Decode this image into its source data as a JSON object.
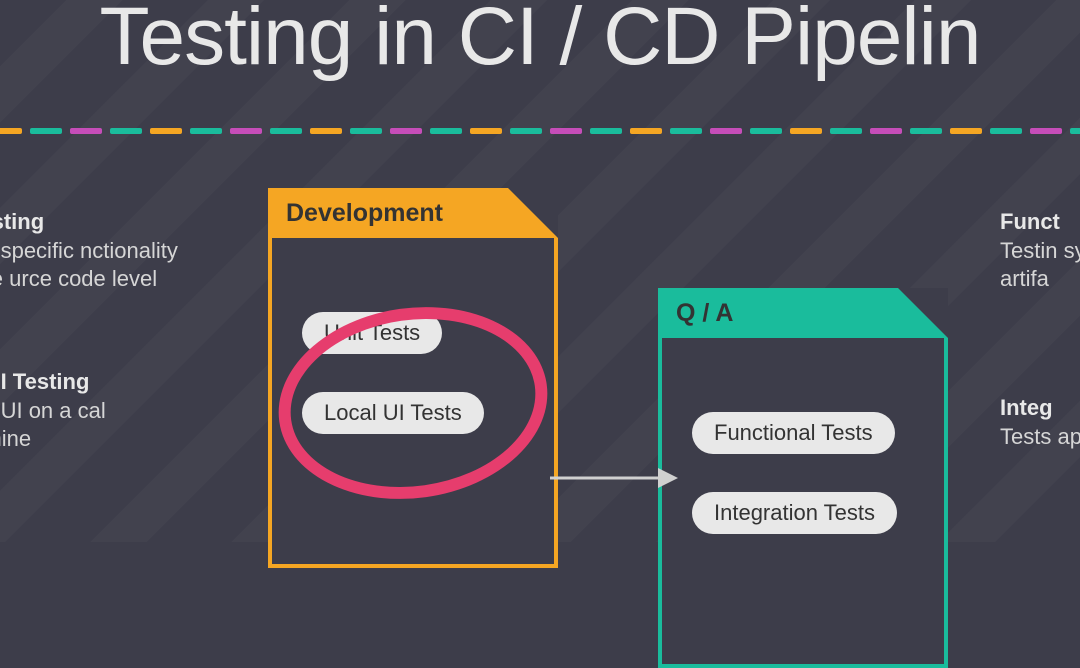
{
  "title": "Testing in CI / CD Pipelin",
  "left_descriptions": [
    {
      "heading": "it Testing",
      "body": "sting specific nctionality at the urce code level"
    },
    {
      "heading": "cal UI Testing",
      "body": "sting UI on a cal machine"
    }
  ],
  "right_descriptions": [
    {
      "heading": "Funct",
      "body": "Testin syste testin artifa"
    },
    {
      "heading": "Integ",
      "body": "Tests appli asso"
    }
  ],
  "stages": {
    "development": {
      "label": "Development",
      "pills": [
        "Unit Tests",
        "Local UI Tests"
      ]
    },
    "qa": {
      "label": "Q / A",
      "pills": [
        "Functional Tests",
        "Integration Tests"
      ]
    }
  },
  "divider_pattern": [
    "d0",
    "d1",
    "d2",
    "d3",
    "d0",
    "d1",
    "d2",
    "d3",
    "d0",
    "d1",
    "d2",
    "d3",
    "d0",
    "d1",
    "d2",
    "d3",
    "d0",
    "d1",
    "d2",
    "d3",
    "d0",
    "d1",
    "d2",
    "d3",
    "d0",
    "d1",
    "d2",
    "d3",
    "d0",
    "d1"
  ]
}
